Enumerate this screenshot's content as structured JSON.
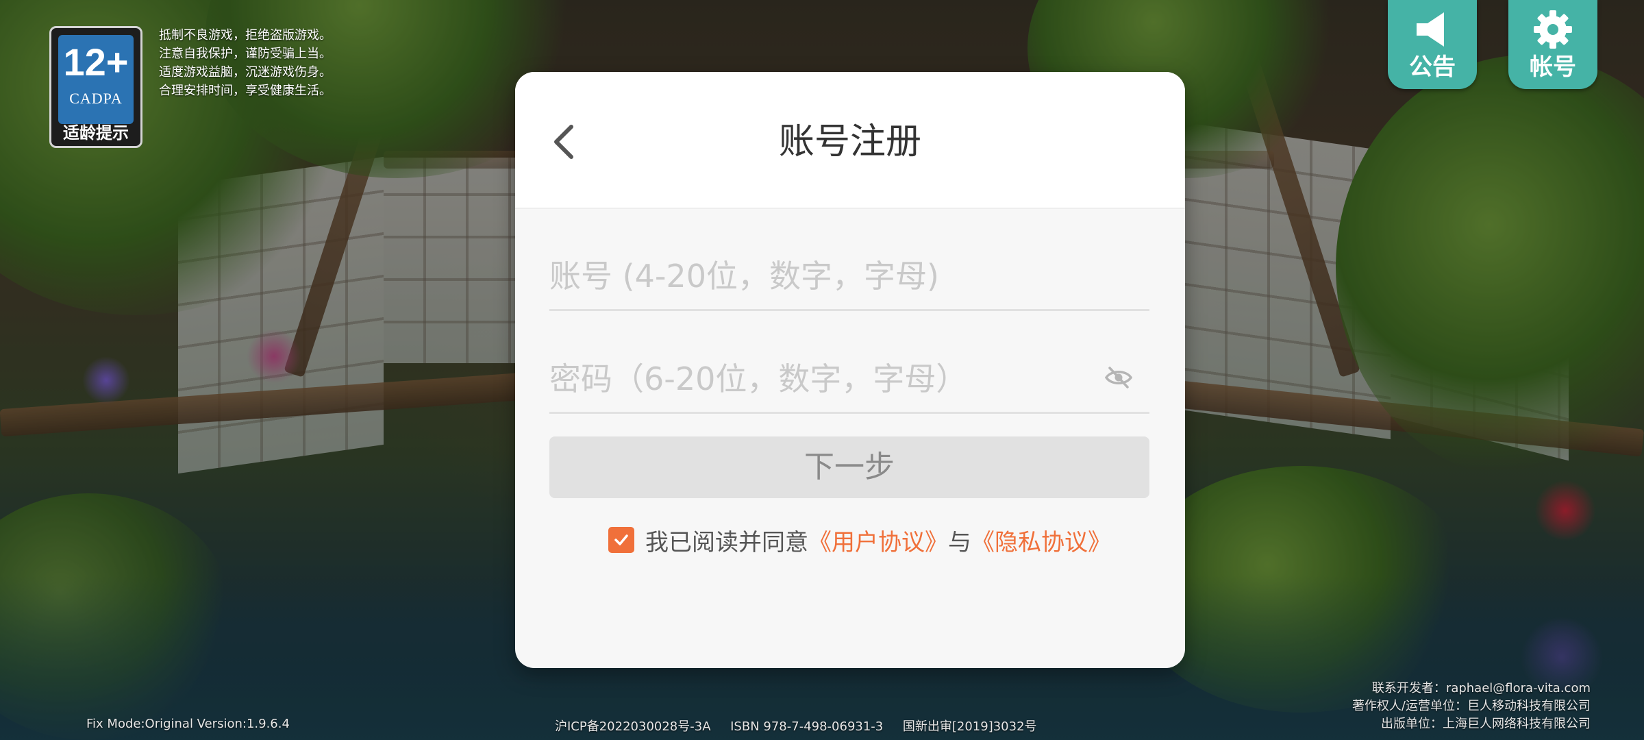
{
  "age_badge": {
    "age": "12+",
    "org": "CADPA",
    "label": "适龄提示"
  },
  "health_notice": [
    "抵制不良游戏，拒绝盗版游戏。",
    "注意自我保护，谨防受骗上当。",
    "适度游戏益脑，沉迷游戏伤身。",
    "合理安排时间，享受健康生活。"
  ],
  "top_buttons": {
    "notice_label": "公告",
    "notice_icon": "megaphone-icon",
    "account_label": "帐号",
    "account_icon": "gear-icon"
  },
  "dialog": {
    "title": "账号注册",
    "account_placeholder": "账号 (4-20位，数字，字母)",
    "password_placeholder": "密码（6-20位，数字，字母）",
    "next_label": "下一步",
    "agree_text": "我已阅读并同意",
    "user_agreement": "《用户协议》",
    "conjunction": "与",
    "privacy_agreement": "《隐私协议》",
    "agreed": true
  },
  "footer": {
    "version": "Fix Mode:Original Version:1.9.6.4",
    "license": "沪ICP备2022030028号-3A     ISBN 978-7-498-06931-3     国新出审[2019]3032号",
    "contact": "联系开发者：raphael@flora-vita.com",
    "copyright": "著作权人/运营单位：巨人移动科技有限公司",
    "publisher": "出版单位：上海巨人网络科技有限公司"
  },
  "colors": {
    "accent": "#f0703a",
    "corner_button": "#45b3a6",
    "badge_blue": "#2b73b3"
  }
}
